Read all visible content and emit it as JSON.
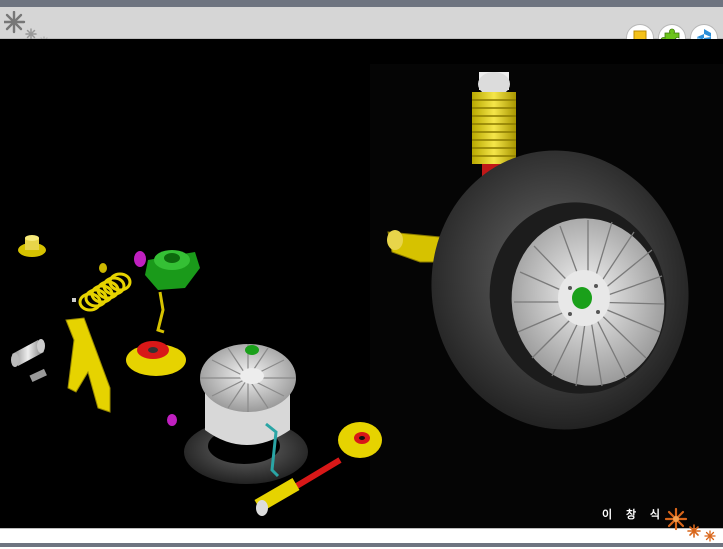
{
  "window": {
    "background": "#000000",
    "header_color": "#d6d6d6",
    "frame_color": "#6e7480"
  },
  "header": {
    "logo_icon": "snowflake-cluster-icon",
    "buttons": [
      {
        "icon": "note-icon",
        "color": "#f3c11a"
      },
      {
        "icon": "puzzle-icon",
        "color": "#6cc41b"
      },
      {
        "icon": "gear-3d-icon",
        "color": "#2b8fd9"
      }
    ]
  },
  "scene": {
    "left_view": "exploded-suspension-assembly",
    "right_view": "assembled-wheel-suspension"
  },
  "footer": {
    "signature": "이 창 식",
    "deco_icon": "orange-flower-icon",
    "accent": "#d9661a"
  }
}
